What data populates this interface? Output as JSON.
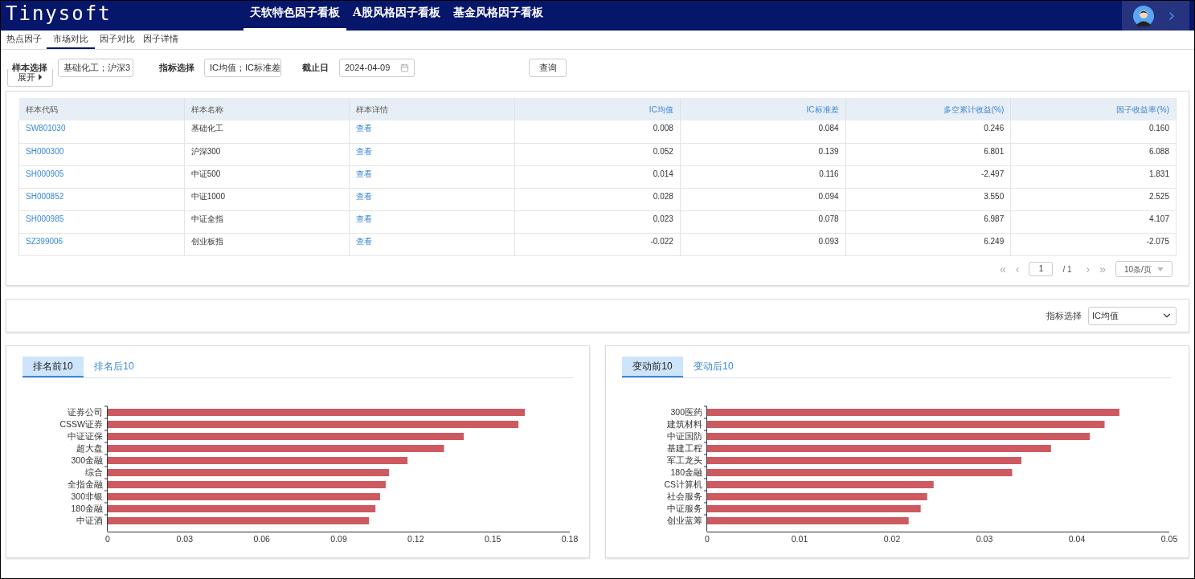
{
  "header": {
    "logo": "Tinysoft",
    "nav": [
      {
        "label": "天软特色因子看板",
        "selected": true
      },
      {
        "label": "A股风格因子看板",
        "selected": false
      },
      {
        "label": "基金风格因子看板",
        "selected": false
      }
    ]
  },
  "subtabs": [
    {
      "label": "热点因子",
      "selected": false
    },
    {
      "label": "市场对比",
      "selected": true
    },
    {
      "label": "因子对比",
      "selected": false
    },
    {
      "label": "因子详情",
      "selected": false
    }
  ],
  "filters": {
    "sample_label": "样本选择",
    "sample_value": "基础化工；沪深3",
    "metric_label": "指标选择",
    "metric_value": "IC均值；IC标准差",
    "date_label": "截止日",
    "date_value": "2024-04-09",
    "query_button": "查询",
    "expand_button": "展开 ⏵"
  },
  "table": {
    "columns": [
      {
        "label": "样本代码",
        "numeric": false
      },
      {
        "label": "样本名称",
        "numeric": false
      },
      {
        "label": "样本详情",
        "numeric": false
      },
      {
        "label": "IC均值",
        "numeric": true
      },
      {
        "label": "IC标准差",
        "numeric": true
      },
      {
        "label": "多空累计收益(%)",
        "numeric": true
      },
      {
        "label": "因子收益率(%)",
        "numeric": true
      }
    ],
    "rows": [
      {
        "code": "SW801030",
        "name": "基础化工",
        "detail": "查看",
        "values": [
          "0.008",
          "0.084",
          "0.246",
          "0.160"
        ]
      },
      {
        "code": "SH000300",
        "name": "沪深300",
        "detail": "查看",
        "values": [
          "0.052",
          "0.139",
          "6.801",
          "6.088"
        ]
      },
      {
        "code": "SH000905",
        "name": "中证500",
        "detail": "查看",
        "values": [
          "0.014",
          "0.116",
          "-2.497",
          "1.831"
        ]
      },
      {
        "code": "SH000852",
        "name": "中证1000",
        "detail": "查看",
        "values": [
          "0.028",
          "0.094",
          "3.550",
          "2.525"
        ]
      },
      {
        "code": "SH000985",
        "name": "中证全指",
        "detail": "查看",
        "values": [
          "0.023",
          "0.078",
          "6.987",
          "4.107"
        ]
      },
      {
        "code": "SZ399006",
        "name": "创业板指",
        "detail": "查看",
        "values": [
          "-0.022",
          "0.093",
          "6.249",
          "-2.075"
        ]
      }
    ]
  },
  "pagination": {
    "first": "«",
    "prev": "‹",
    "page": "1",
    "total": "/ 1",
    "next": "›",
    "last": "»",
    "page_size": "10条/页"
  },
  "indicator": {
    "label": "指标选择",
    "value": "IC均值"
  },
  "panels": [
    {
      "tabs": [
        {
          "label": "排名前10",
          "selected": true
        },
        {
          "label": "排名后10",
          "selected": false
        }
      ],
      "chart_data": {
        "type": "bar",
        "orientation": "horizontal",
        "categories": [
          "证券公司",
          "CSSW证券",
          "中证证保",
          "超大盘",
          "300金融",
          "综合",
          "全指金融",
          "300非银",
          "180金融",
          "中证酒"
        ],
        "series": [
          {
            "color": "#cd5a60",
            "values": [
              0.1625,
              0.16,
              0.1387,
              0.131,
              0.1168,
              0.1096,
              0.1083,
              0.1061,
              0.1043,
              0.1018
            ]
          }
        ],
        "xlim": [
          0,
          0.18
        ],
        "xticks": [
          {
            "value": 0,
            "label": "0"
          },
          {
            "value": 0.03,
            "label": "0.03"
          },
          {
            "value": 0.06,
            "label": "0.06"
          },
          {
            "value": 0.09,
            "label": "0.09"
          },
          {
            "value": 0.12,
            "label": "0.12"
          },
          {
            "value": 0.15,
            "label": "0.15"
          },
          {
            "value": 0.18,
            "label": "0.18"
          }
        ]
      }
    },
    {
      "tabs": [
        {
          "label": "变动前10",
          "selected": true
        },
        {
          "label": "变动后10",
          "selected": false
        }
      ],
      "chart_data": {
        "type": "bar",
        "orientation": "horizontal",
        "categories": [
          "300医药",
          "建筑材料",
          "中证国防",
          "基建工程",
          "军工龙头",
          "180金融",
          "CS计算机",
          "社会服务",
          "中证服务",
          "创业蓝筹"
        ],
        "series": [
          {
            "color": "#cd5a60",
            "values": [
              0.0446,
              0.043,
              0.0414,
              0.0372,
              0.034,
              0.033,
              0.0245,
              0.0238,
              0.0231,
              0.0218
            ]
          }
        ],
        "xlim": [
          0,
          0.05
        ],
        "xticks": [
          {
            "value": 0,
            "label": "0"
          },
          {
            "value": 0.01,
            "label": "0.01"
          },
          {
            "value": 0.02,
            "label": "0.02"
          },
          {
            "value": 0.03,
            "label": "0.03"
          },
          {
            "value": 0.04,
            "label": "0.04"
          },
          {
            "value": 0.05,
            "label": "0.05"
          }
        ]
      }
    }
  ]
}
